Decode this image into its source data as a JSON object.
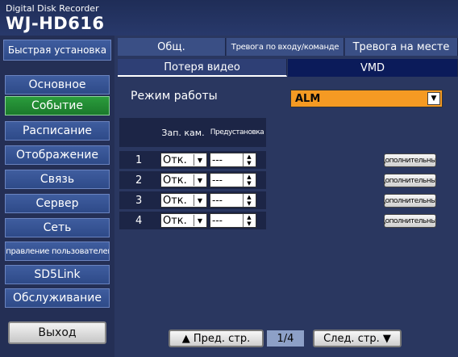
{
  "header": {
    "subtitle": "Digital Disk Recorder",
    "model": "WJ-HD616"
  },
  "sidebar": {
    "quick_setup": "Быстрая установка",
    "items": [
      {
        "label": "Основное",
        "active": false
      },
      {
        "label": "Событие",
        "active": true
      },
      {
        "label": "Расписание",
        "active": false
      },
      {
        "label": "Отображение",
        "active": false
      },
      {
        "label": "Связь",
        "active": false
      },
      {
        "label": "Сервер",
        "active": false
      },
      {
        "label": "Сеть",
        "active": false
      },
      {
        "label": "Управление пользователем",
        "active": false
      },
      {
        "label": "SD5Link",
        "active": false
      },
      {
        "label": "Обслуживание",
        "active": false
      }
    ],
    "exit": "Выход"
  },
  "tabs_row1": [
    {
      "label": "Общ."
    },
    {
      "label": "Тревога по входу/команде"
    },
    {
      "label": "Тревога на месте"
    }
  ],
  "tabs_row2": [
    {
      "label": "Потеря видео",
      "active": true
    },
    {
      "label": "VMD",
      "active": false
    }
  ],
  "mode": {
    "label": "Режим работы",
    "value": "ALM"
  },
  "table": {
    "headers": [
      "Зап. кам.",
      "Предустановка"
    ],
    "rows": [
      {
        "num": "1",
        "rec": "Отк.",
        "preset": "---",
        "advanced": "Дополнительные"
      },
      {
        "num": "2",
        "rec": "Отк.",
        "preset": "---",
        "advanced": "Дополнительные"
      },
      {
        "num": "3",
        "rec": "Отк.",
        "preset": "---",
        "advanced": "Дополнительные"
      },
      {
        "num": "4",
        "rec": "Отк.",
        "preset": "---",
        "advanced": "Дополнительные"
      }
    ]
  },
  "pager": {
    "prev": "▲ Пред. стр.",
    "page": "1/4",
    "next": "След. стр. ▼"
  },
  "colors": {
    "background": "#2a3760",
    "active_green": "#1b7a2b",
    "mode_orange": "#f59a23"
  }
}
